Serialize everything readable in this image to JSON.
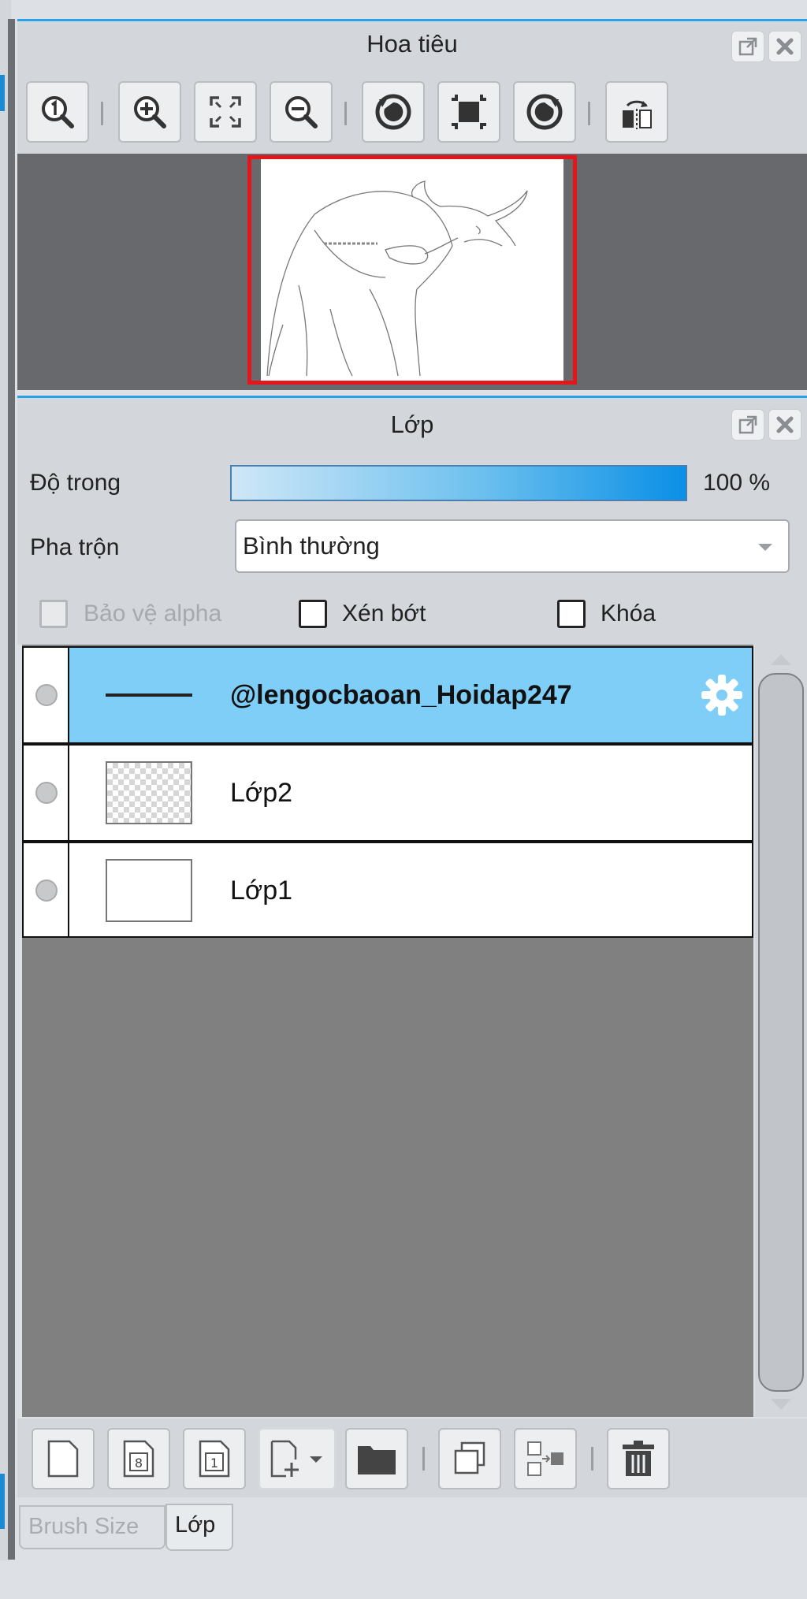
{
  "navigator": {
    "title": "Hoa tiêu",
    "toolbar_icons": [
      "zoom-actual-icon",
      "zoom-in-icon",
      "fit-to-window-icon",
      "zoom-out-icon",
      "rotate-left-icon",
      "reset-view-icon",
      "rotate-right-icon",
      "flip-horizontal-icon"
    ]
  },
  "layers_panel": {
    "title": "Lớp",
    "opacity": {
      "label": "Độ trong",
      "value": "100 %",
      "fraction": 1.0
    },
    "blend": {
      "label": "Pha trộn",
      "value": "Bình thường"
    },
    "checkboxes": [
      {
        "label": "Bảo vệ alpha",
        "checked": false,
        "enabled": false
      },
      {
        "label": "Xén bớt",
        "checked": false,
        "enabled": true
      },
      {
        "label": "Khóa",
        "checked": false,
        "enabled": true
      }
    ],
    "layers": [
      {
        "name": "@lengocbaoan_Hoidap247",
        "selected": true
      },
      {
        "name": "Lớp2",
        "selected": false
      },
      {
        "name": "Lớp1",
        "selected": false
      }
    ],
    "bottom_icons": [
      "new-layer-icon",
      "new-8bit-layer-icon",
      "new-1bit-layer-icon",
      "add-layer-dropdown-icon",
      "new-folder-icon",
      "duplicate-layer-icon",
      "merge-down-icon",
      "delete-layer-icon"
    ]
  },
  "tabs": [
    {
      "label": "Brush Size",
      "active": false
    },
    {
      "label": "Lớp",
      "active": true
    }
  ],
  "colors": {
    "accent": "#2aa0e6",
    "selected_row": "#7fcef7",
    "nav_frame": "#e4161c"
  }
}
